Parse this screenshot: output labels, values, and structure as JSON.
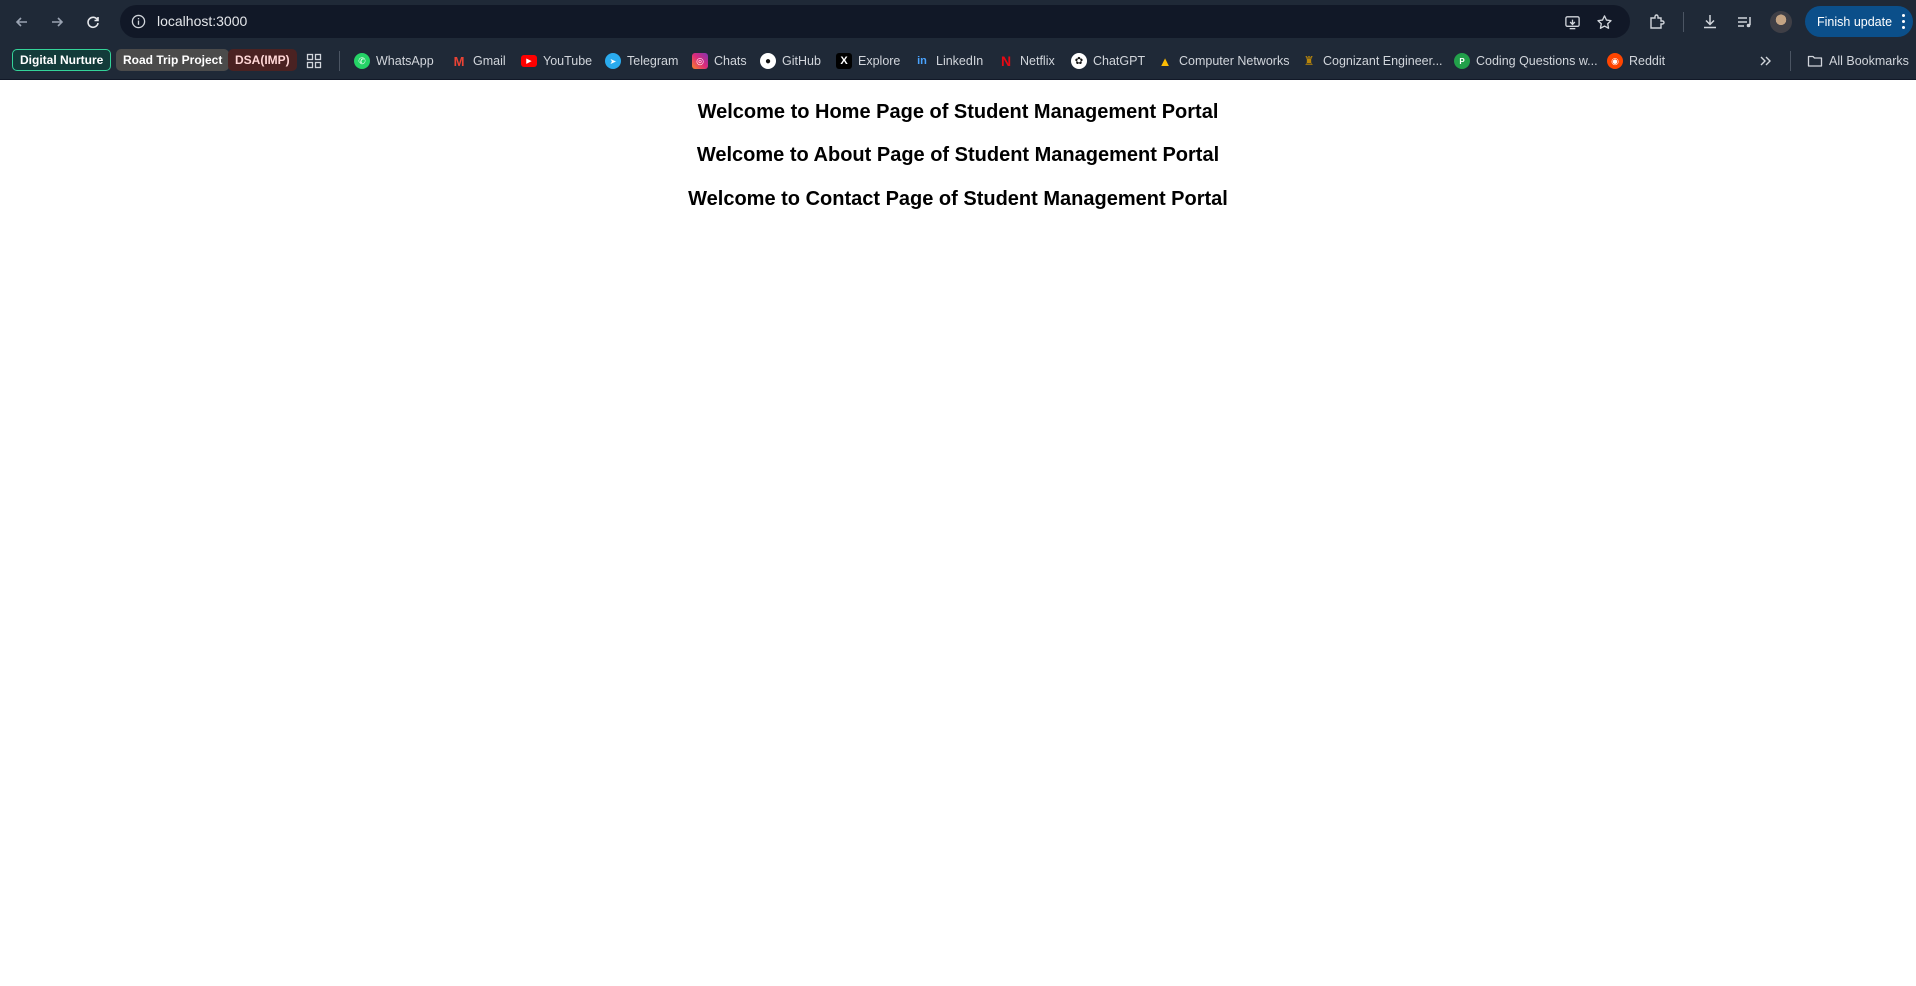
{
  "browser": {
    "url": "localhost:3000",
    "finish_update_label": "Finish update"
  },
  "bookmarks": {
    "chips": [
      {
        "label": "Digital Nurture"
      },
      {
        "label": "Road Trip Project"
      },
      {
        "label": "DSA(IMP)"
      }
    ],
    "items": [
      {
        "label": "WhatsApp",
        "icon": "whatsapp-icon"
      },
      {
        "label": "Gmail",
        "icon": "gmail-icon"
      },
      {
        "label": "YouTube",
        "icon": "youtube-icon"
      },
      {
        "label": "Telegram",
        "icon": "telegram-icon"
      },
      {
        "label": "Chats",
        "icon": "instagram-icon"
      },
      {
        "label": "GitHub",
        "icon": "github-icon"
      },
      {
        "label": "Explore",
        "icon": "x-icon"
      },
      {
        "label": "LinkedIn",
        "icon": "linkedin-icon"
      },
      {
        "label": "Netflix",
        "icon": "netflix-icon"
      },
      {
        "label": "ChatGPT",
        "icon": "chatgpt-icon"
      },
      {
        "label": "Computer Networks",
        "icon": "google-drive-icon"
      },
      {
        "label": "Cognizant Engineer...",
        "icon": "cognizant-icon"
      },
      {
        "label": "Coding Questions w...",
        "icon": "coding-icon"
      },
      {
        "label": "Reddit",
        "icon": "reddit-icon"
      }
    ],
    "all_bookmarks_label": "All Bookmarks"
  },
  "page": {
    "headings": [
      "Welcome to Home Page of Student Management Portal",
      "Welcome to About Page of Student Management Portal",
      "Welcome to Contact Page of Student Management Portal"
    ]
  },
  "colors": {
    "toolbar_bg": "#1f2937",
    "omnibox_bg": "#111827",
    "finish_update_bg": "#0b4f8a",
    "page_bg": "#ffffff"
  }
}
